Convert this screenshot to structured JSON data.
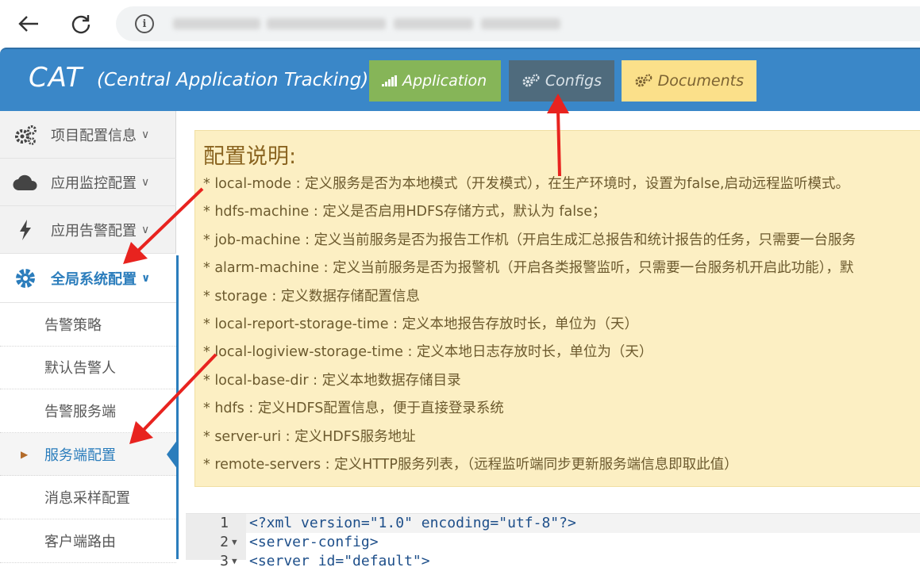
{
  "browser": {
    "back_icon": "arrow-left-icon",
    "reload_icon": "reload-icon",
    "info_glyph": "i"
  },
  "header": {
    "brand": "CAT",
    "brand_sub": "(Central Application Tracking)",
    "buttons": [
      {
        "label": "Application",
        "icon": "signal-icon",
        "color": "#86b558"
      },
      {
        "label": "Configs",
        "icon": "gears-icon",
        "color": "#4f6b7d"
      },
      {
        "label": "Documents",
        "icon": "gears-icon",
        "color": "#fbe08a"
      }
    ]
  },
  "sidebar": {
    "items": [
      {
        "label": "项目配置信息",
        "icon": "gears-icon"
      },
      {
        "label": "应用监控配置",
        "icon": "cloud-icon"
      },
      {
        "label": "应用告警配置",
        "icon": "bolt-icon"
      },
      {
        "label": "全局系统配置",
        "icon": "gear-icon"
      }
    ],
    "chevron": "∨",
    "sub_items": [
      "告警策略",
      "默认告警人",
      "告警服务端",
      "服务端配置",
      "消息采样配置",
      "客户端路由"
    ]
  },
  "note": {
    "title": "配置说明:",
    "lines": [
      "* local-mode : 定义服务是否为本地模式（开发模式），在生产环境时，设置为false,启动远程监听模式。",
      "* hdfs-machine : 定义是否启用HDFS存储方式，默认为 false；",
      "* job-machine : 定义当前服务是否为报告工作机（开启生成汇总报告和统计报告的任务，只需要一台服务",
      "* alarm-machine : 定义当前服务是否为报警机（开启各类报警监听，只需要一台服务机开启此功能），默",
      "* storage : 定义数据存储配置信息",
      "* local-report-storage-time : 定义本地报告存放时长，单位为（天）",
      "* local-logiview-storage-time : 定义本地日志存放时长，单位为（天）",
      "* local-base-dir : 定义本地数据存储目录",
      "* hdfs : 定义HDFS配置信息，便于直接登录系统",
      "* server-uri : 定义HDFS服务地址",
      "* remote-servers : 定义HTTP服务列表，（远程监听端同步更新服务端信息即取此值）"
    ]
  },
  "code": {
    "lines": [
      {
        "num": "1",
        "text": "<?xml version=\"1.0\" encoding=\"utf-8\"?>"
      },
      {
        "num": "2",
        "text": "<server-config>"
      },
      {
        "num": "3",
        "text": "   <server id=\"default\">"
      }
    ]
  },
  "colors": {
    "header_bg": "#3a87c8",
    "accent": "#2b7dbc",
    "note_bg": "#fcefc3",
    "arrow": "#e8231f"
  }
}
